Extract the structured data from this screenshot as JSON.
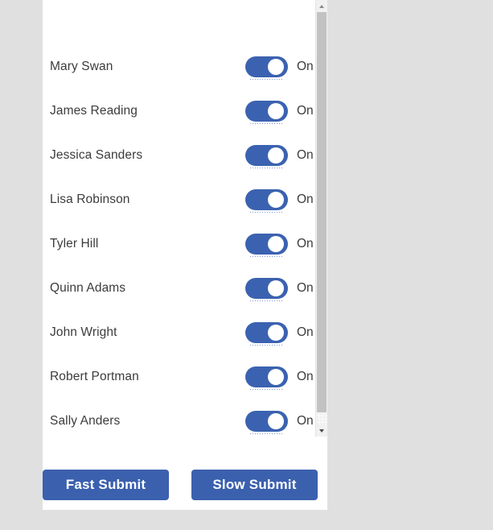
{
  "page": {
    "background_color": "#e0e0e0",
    "panel_background": "#ffffff",
    "accent_color": "#3b62b0",
    "button_color": "#3b60ae"
  },
  "list": {
    "people": [
      {
        "name": "Mary Swan",
        "toggle_state": "On",
        "toggle_on": true
      },
      {
        "name": "James Reading",
        "toggle_state": "On",
        "toggle_on": true
      },
      {
        "name": "Jessica Sanders",
        "toggle_state": "On",
        "toggle_on": true
      },
      {
        "name": "Lisa Robinson",
        "toggle_state": "On",
        "toggle_on": true
      },
      {
        "name": "Tyler Hill",
        "toggle_state": "On",
        "toggle_on": true
      },
      {
        "name": "Quinn Adams",
        "toggle_state": "On",
        "toggle_on": true
      },
      {
        "name": "John Wright",
        "toggle_state": "On",
        "toggle_on": true
      },
      {
        "name": "Robert Portman",
        "toggle_state": "On",
        "toggle_on": true
      },
      {
        "name": "Sally Anders",
        "toggle_state": "On",
        "toggle_on": true
      }
    ]
  },
  "scrollbar": {
    "up_arrow_icon": "chevron-up-icon",
    "down_arrow_icon": "chevron-down-icon"
  },
  "footer": {
    "fast_submit_label": "Fast Submit",
    "slow_submit_label": "Slow Submit"
  }
}
